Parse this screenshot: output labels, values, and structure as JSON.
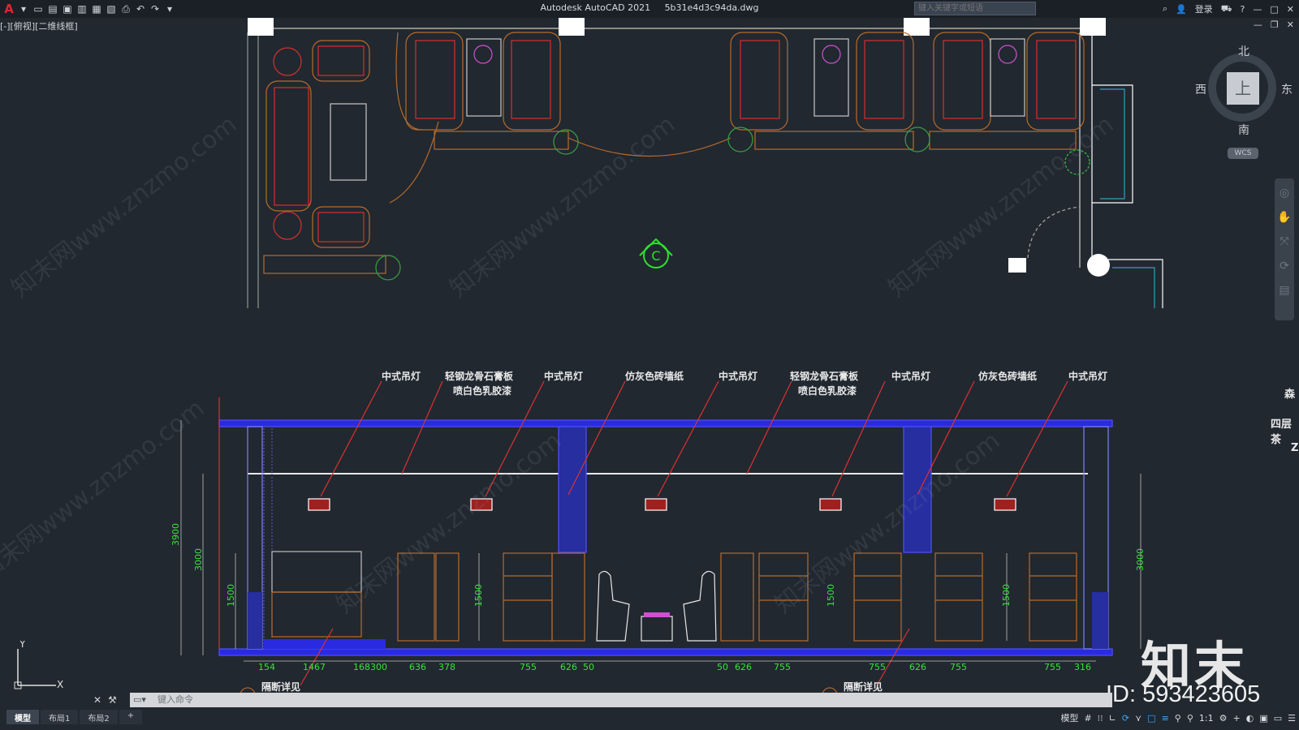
{
  "app": {
    "title": "Autodesk AutoCAD 2021",
    "filename": "5b31e4d3c94da.dwg",
    "search_placeholder": "键入关键字或短语",
    "login_label": "登录",
    "view_label": "[-][俯视][二维线框]"
  },
  "viewcube": {
    "north": "北",
    "south": "南",
    "east": "东",
    "west": "西",
    "face": "上",
    "wcs": "WCS"
  },
  "plan": {
    "marker": "C"
  },
  "elevation": {
    "callouts": [
      "中式吊灯",
      "轻钢龙骨石膏板",
      "喷白色乳胶漆",
      "中式吊灯",
      "仿灰色砖墙纸",
      "中式吊灯",
      "轻钢龙骨石膏板",
      "喷白色乳胶漆",
      "中式吊灯",
      "仿灰色砖墙纸",
      "中式吊灯"
    ],
    "dims_bottom": [
      "154",
      "1467",
      "168300",
      "636",
      "378",
      "755",
      "626",
      "50",
      "50",
      "626",
      "755",
      "755",
      "626",
      "755",
      "755",
      "316"
    ],
    "dims_left": [
      "3900",
      "3000",
      "1500"
    ],
    "dims_inner": [
      "1500",
      "1500",
      "1500",
      "1500"
    ],
    "dims_right": [
      "3000"
    ],
    "section_labels": [
      "隔断详见",
      "隔断详见"
    ]
  },
  "side_panel": {
    "label1": "森",
    "label2": "四层茶",
    "label3": "Z"
  },
  "watermark": {
    "brand": "知末",
    "id": "ID: 593423605",
    "text": "知末网www.znzmo.com"
  },
  "command": {
    "placeholder": "键入命令"
  },
  "tabs": [
    "模型",
    "布局1",
    "布局2",
    "+"
  ],
  "status": {
    "model": "模型",
    "scale": "1:1"
  }
}
